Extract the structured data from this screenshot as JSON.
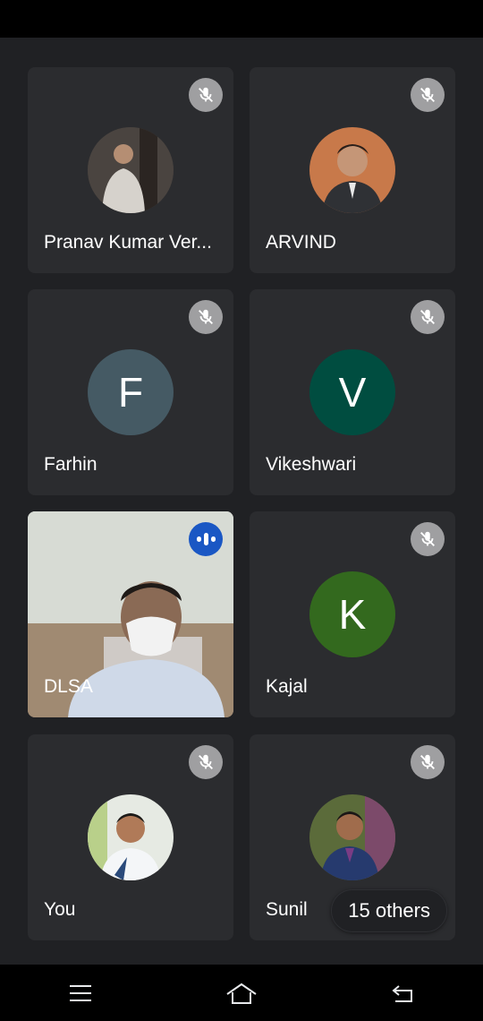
{
  "participants": [
    {
      "name": "Pranav Kumar Ver...",
      "muted": true,
      "avatar_type": "photo",
      "avatar_colors": [
        "#6b6e70",
        "#2f2c2a"
      ]
    },
    {
      "name": "ARVIND",
      "muted": true,
      "avatar_type": "photo",
      "avatar_colors": [
        "#c47a4a",
        "#3b2a22"
      ]
    },
    {
      "name": "Farhin",
      "muted": true,
      "avatar_type": "initial",
      "initial": "F",
      "avatar_color": "#455a64"
    },
    {
      "name": "Vikeshwari",
      "muted": true,
      "avatar_type": "initial",
      "initial": "V",
      "avatar_color": "#004d40"
    },
    {
      "name": "DLSA",
      "muted": false,
      "speaking": true,
      "avatar_type": "video"
    },
    {
      "name": "Kajal",
      "muted": true,
      "avatar_type": "initial",
      "initial": "K",
      "avatar_color": "#33691e"
    },
    {
      "name": "You",
      "muted": true,
      "avatar_type": "photo",
      "avatar_colors": [
        "#e9ece6",
        "#2a2a2a"
      ]
    },
    {
      "name": "Sunil",
      "muted": true,
      "avatar_type": "photo",
      "avatar_colors": [
        "#3a5a2a",
        "#2b3a6a"
      ]
    }
  ],
  "others_pill": "15 others",
  "icons": {
    "muted": "mic-off-icon",
    "speaking": "audio-level-icon"
  },
  "nav": {
    "menu": "menu-icon",
    "home": "home-icon",
    "back": "back-icon"
  }
}
